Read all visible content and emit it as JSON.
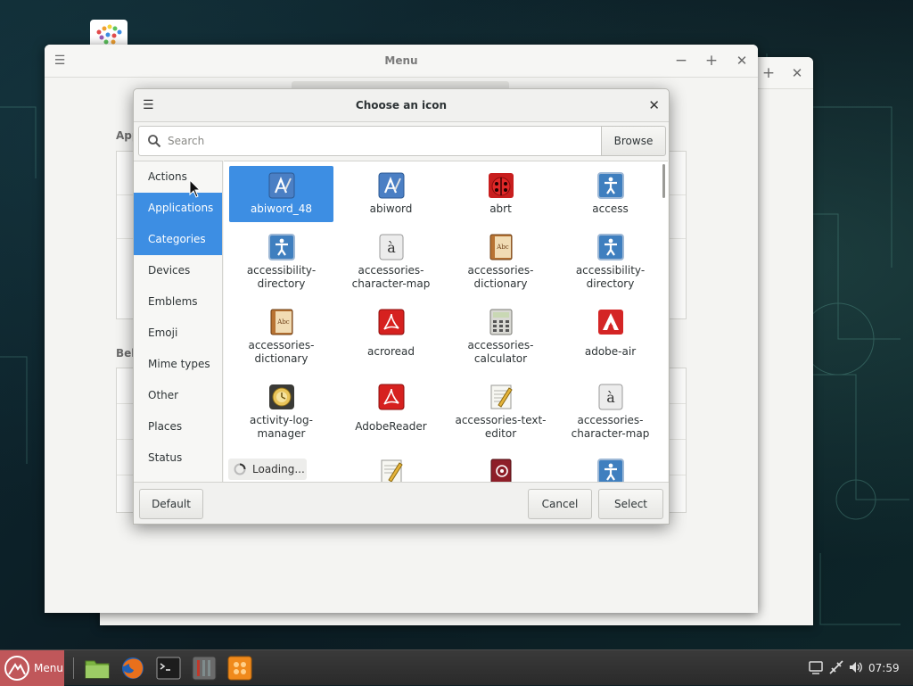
{
  "menu_window": {
    "title": "Menu",
    "section_applications": "App",
    "section_behaviour": "Beh"
  },
  "dialog": {
    "title": "Choose an icon",
    "search": {
      "placeholder": "Search",
      "value": ""
    },
    "browse_label": "Browse",
    "categories": [
      {
        "label": "Actions",
        "selected": false
      },
      {
        "label": "Applications",
        "selected": true
      },
      {
        "label": "Categories",
        "selected": true
      },
      {
        "label": "Devices",
        "selected": false
      },
      {
        "label": "Emblems",
        "selected": false
      },
      {
        "label": "Emoji",
        "selected": false
      },
      {
        "label": "Mime types",
        "selected": false
      },
      {
        "label": "Other",
        "selected": false
      },
      {
        "label": "Places",
        "selected": false
      },
      {
        "label": "Status",
        "selected": false
      }
    ],
    "icons": [
      {
        "label": "abiword_48",
        "icon": "abiword-icon",
        "selected": true
      },
      {
        "label": "abiword",
        "icon": "abiword-icon",
        "selected": false
      },
      {
        "label": "abrt",
        "icon": "abrt-ladybug-icon",
        "selected": false
      },
      {
        "label": "access",
        "icon": "accessibility-icon",
        "selected": false
      },
      {
        "label": "accessibility-directory",
        "icon": "accessibility-icon",
        "selected": false
      },
      {
        "label": "accessories-character-map",
        "icon": "character-map-icon",
        "selected": false
      },
      {
        "label": "accessories-dictionary",
        "icon": "dictionary-icon",
        "selected": false
      },
      {
        "label": "accessibility-directory",
        "icon": "accessibility-icon",
        "selected": false
      },
      {
        "label": "accessories-dictionary",
        "icon": "dictionary-icon",
        "selected": false
      },
      {
        "label": "acroread",
        "icon": "acrobat-icon",
        "selected": false
      },
      {
        "label": "accessories-calculator",
        "icon": "calculator-icon",
        "selected": false
      },
      {
        "label": "adobe-air",
        "icon": "adobe-air-icon",
        "selected": false
      },
      {
        "label": "activity-log-manager",
        "icon": "activity-log-icon",
        "selected": false
      },
      {
        "label": "AdobeReader",
        "icon": "acrobat-icon",
        "selected": false
      },
      {
        "label": "accessories-text-editor",
        "icon": "text-editor-icon",
        "selected": false
      },
      {
        "label": "accessories-character-map",
        "icon": "character-map-icon",
        "selected": false
      }
    ],
    "partial_icons": [
      "text-editor-icon",
      "address-book-icon",
      "accessibility-icon"
    ],
    "loading_text": "Loading...",
    "default_label": "Default",
    "cancel_label": "Cancel",
    "select_label": "Select"
  },
  "taskbar": {
    "menu_label": "Menu",
    "apps": [
      "file-manager-icon",
      "firefox-icon",
      "terminal-icon",
      "settings-icon",
      "software-manager-icon"
    ],
    "tray": [
      "display-icon",
      "network-icon",
      "volume-icon"
    ],
    "clock": "07:59"
  },
  "colors": {
    "accent": "#3d8ee3",
    "taskbar_menu": "#c0575a"
  }
}
